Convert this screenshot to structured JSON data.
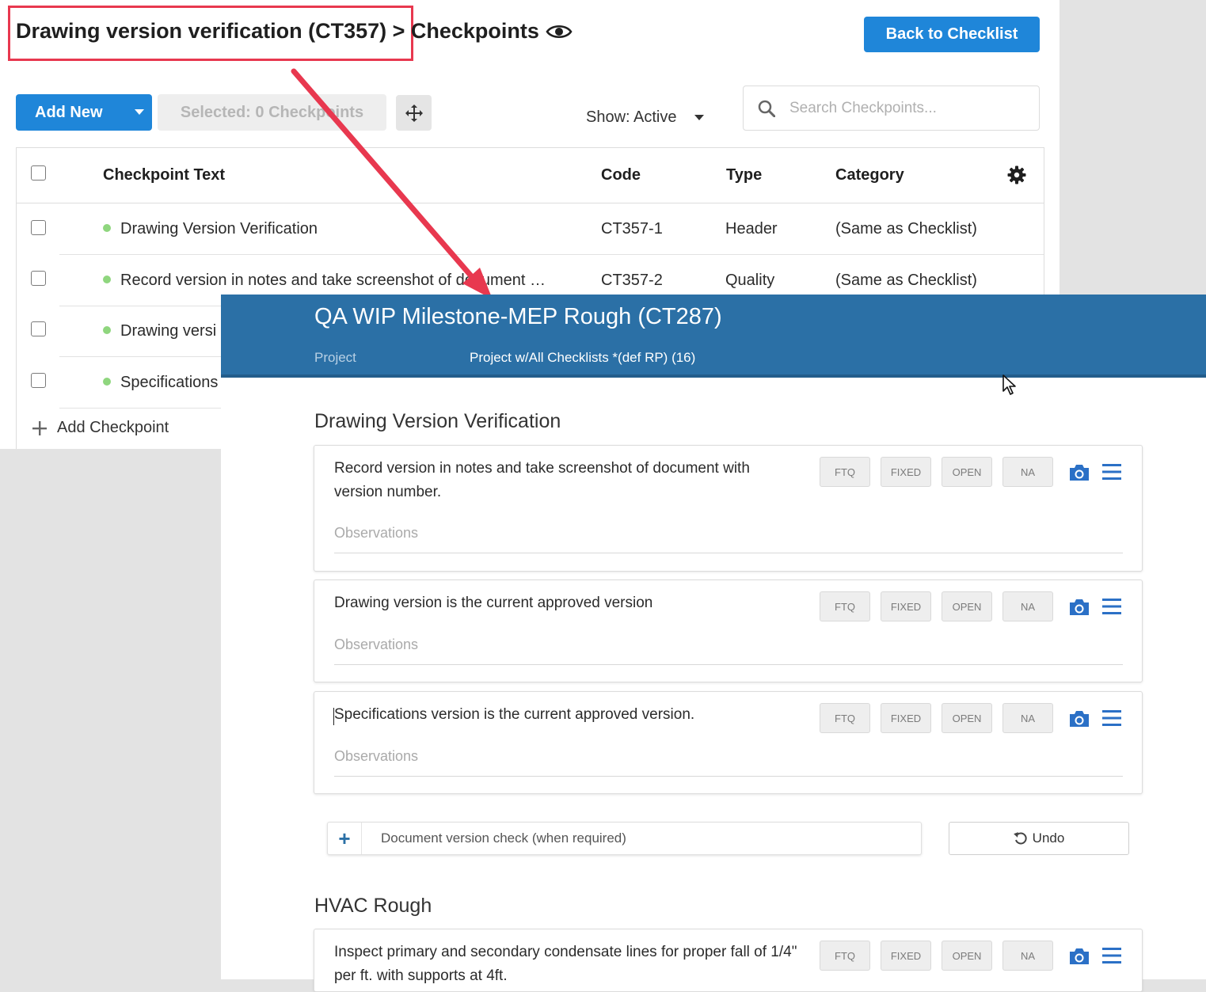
{
  "back_page": {
    "title": "Drawing version verification (CT357) > Checkpoints",
    "back_button": "Back to Checklist",
    "add_new_button": "Add New",
    "selected_label": "Selected: 0 Checkpoints",
    "show_filter": "Show: Active",
    "search_placeholder": "Search Checkpoints...",
    "columns": {
      "text": "Checkpoint Text",
      "code": "Code",
      "type": "Type",
      "category": "Category"
    },
    "rows": [
      {
        "text": "Drawing Version Verification",
        "code": "CT357-1",
        "type": "Header",
        "category": "(Same as Checklist)"
      },
      {
        "text": "Record version in notes and take screenshot of document …",
        "code": "CT357-2",
        "type": "Quality",
        "category": "(Same as Checklist)"
      },
      {
        "text": "Drawing versi",
        "code": "",
        "type": "",
        "category": ""
      },
      {
        "text": "Specifications",
        "code": "",
        "type": "",
        "category": ""
      }
    ],
    "add_checkpoint": "Add Checkpoint"
  },
  "front_panel": {
    "title": "QA WIP Milestone-MEP Rough (CT287)",
    "project_label": "Project",
    "project_value": "Project w/All Checklists *(def RP) (16)",
    "sections": [
      {
        "title": "Drawing Version Verification",
        "items": [
          {
            "text": "Record version in notes and take screenshot of document with version number.",
            "observations_placeholder": "Observations"
          },
          {
            "text": "Drawing version is the current approved version",
            "observations_placeholder": "Observations"
          },
          {
            "text": "Specifications version is the current approved version.",
            "observations_placeholder": "Observations"
          }
        ]
      },
      {
        "title": "HVAC Rough",
        "items": [
          {
            "text": "Inspect primary and secondary condensate lines for proper fall of 1/4\" per ft. with supports at 4ft.",
            "observations_placeholder": ""
          }
        ]
      }
    ],
    "status_buttons": [
      "FTQ",
      "FIXED",
      "OPEN",
      "NA"
    ],
    "add_group_text": "Document version check (when required)",
    "undo_label": "Undo"
  },
  "colors": {
    "primary_blue": "#1f86d9",
    "header_blue": "#2b70a6",
    "annotation_red": "#e8384f",
    "active_dot": "#8fd67e"
  },
  "icons": [
    "eye-icon",
    "caret-down-icon",
    "move-icon",
    "search-icon",
    "gear-icon",
    "plus-icon",
    "camera-icon",
    "menu-icon",
    "undo-icon",
    "cursor-icon"
  ]
}
